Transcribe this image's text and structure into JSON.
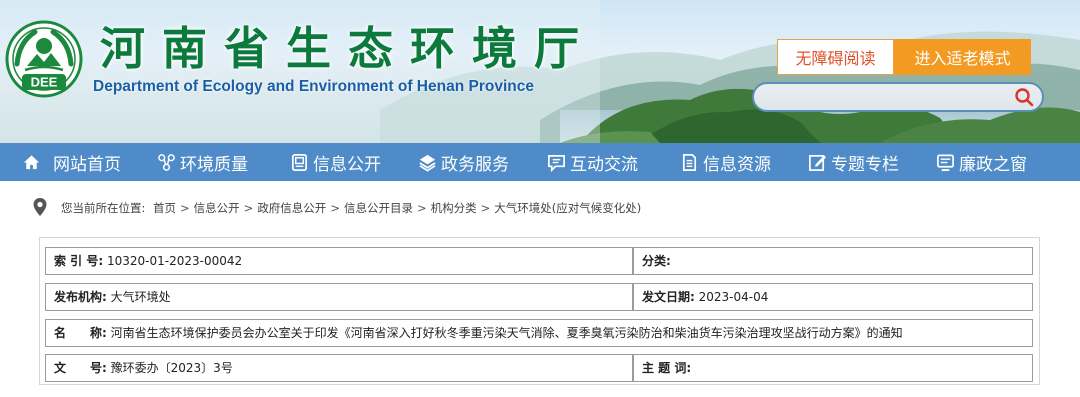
{
  "header": {
    "title": "河南省生态环境厅",
    "subtitle": "Department of Ecology and Environment of Henan Province",
    "logo_text": "DEE",
    "accessibility_label": "无障碍阅读",
    "elder_mode_label": "进入适老模式",
    "search": {
      "placeholder": "",
      "icon": "search-icon"
    }
  },
  "nav": {
    "items": [
      {
        "label": "网站首页",
        "icon": "home-icon"
      },
      {
        "label": "环境质量",
        "icon": "network-icon"
      },
      {
        "label": "信息公开",
        "icon": "document-icon"
      },
      {
        "label": "政务服务",
        "icon": "layers-icon"
      },
      {
        "label": "互动交流",
        "icon": "chat-icon"
      },
      {
        "label": "信息资源",
        "icon": "file-icon"
      },
      {
        "label": "专题专栏",
        "icon": "edit-icon"
      },
      {
        "label": "廉政之窗",
        "icon": "monitor-icon"
      }
    ]
  },
  "breadcrumb": {
    "prefix": "您当前所在位置:",
    "items": [
      "首页",
      "信息公开",
      "政府信息公开",
      "信息公开目录",
      "机构分类",
      "大气环境处(应对气候变化处)"
    ],
    "separator": ">"
  },
  "meta": {
    "index_label": "索 引 号:",
    "index_value": "10320-01-2023-00042",
    "category_label": "分类:",
    "category_value": "",
    "publisher_label": "发布机构:",
    "publisher_value": "大气环境处",
    "date_label": "发文日期:",
    "date_value": "2023-04-04",
    "name_label": "名　　称:",
    "name_value": "河南省生态环境保护委员会办公室关于印发《河南省深入打好秋冬季重污染天气消除、夏季臭氧污染防治和柴油货车污染治理攻坚战行动方案》的通知",
    "docno_label": "文　　号:",
    "docno_value": "豫环委办〔2023〕3号",
    "topic_label": "主 题 词:",
    "topic_value": ""
  },
  "colors": {
    "nav_bg": "#4f8bc9",
    "title_green": "#0d7a3d",
    "subtitle_blue": "#1b5ea8",
    "elder_orange": "#f39a23",
    "access_red": "#e0522a"
  }
}
